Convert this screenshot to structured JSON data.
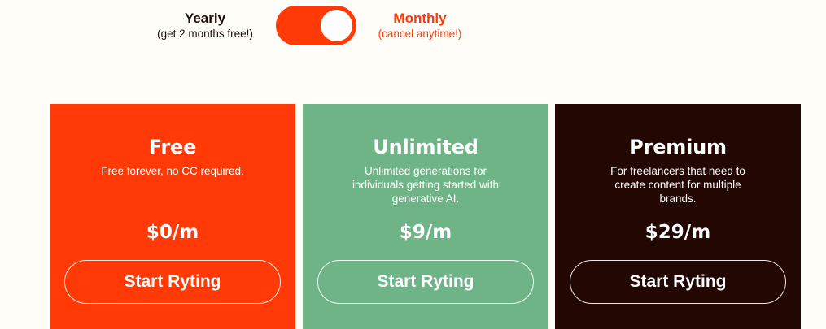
{
  "billing": {
    "yearly_label": "Yearly",
    "yearly_note": "(get 2 months free!)",
    "monthly_label": "Monthly",
    "monthly_note": "(cancel anytime!)",
    "selected": "Monthly"
  },
  "plans": [
    {
      "name": "Free",
      "description": "Free forever, no CC required.",
      "price": "$0/m",
      "button_label": "Start Ryting",
      "color": "#ff3a06"
    },
    {
      "name": "Unlimited",
      "description": "Unlimited generations for individuals getting started with generative AI.",
      "price": "$9/m",
      "button_label": "Start Ryting",
      "color": "#6eb486"
    },
    {
      "name": "Premium",
      "description": "For freelancers that need to create content for multiple brands.",
      "price": "$29/m",
      "button_label": "Start Ryting",
      "color": "#220703"
    }
  ],
  "colors": {
    "background": "#fefdf8",
    "accent": "#ff3a06",
    "dark_text": "#1f0d08"
  }
}
